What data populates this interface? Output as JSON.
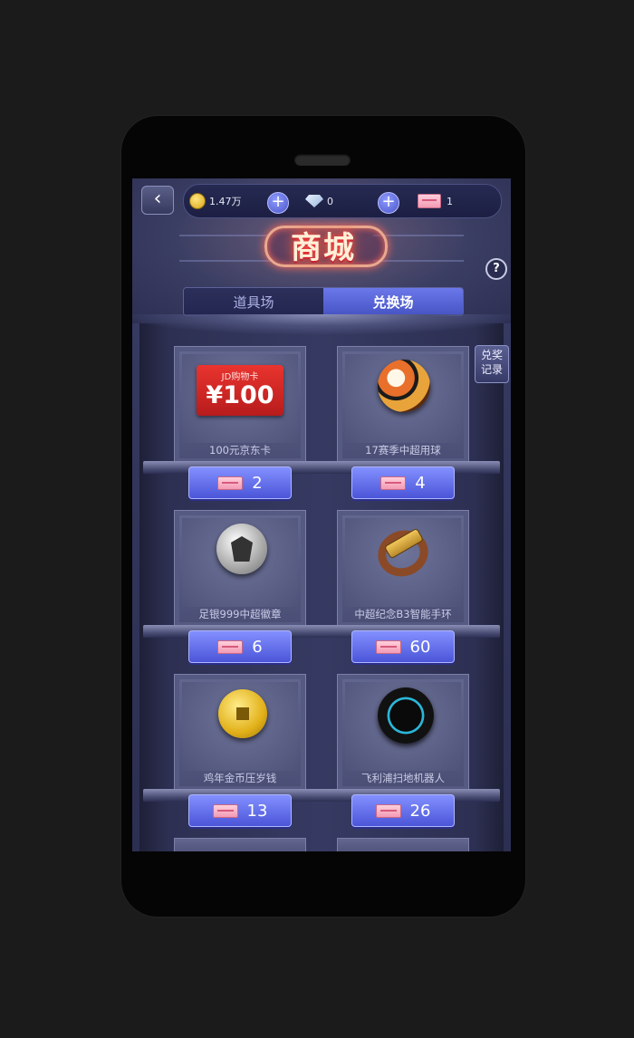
{
  "header": {
    "back_icon": "chevron-left-icon",
    "coins": "1.47万",
    "diamonds": "0",
    "tickets": "1",
    "title": "商城",
    "help": "?"
  },
  "tabs": [
    {
      "label": "道具场",
      "active": false
    },
    {
      "label": "兑换场",
      "active": true
    }
  ],
  "side_button": {
    "line1": "兑奖",
    "line2": "记录"
  },
  "items": [
    {
      "name": "100元京东卡",
      "price": "2",
      "art": "jd-card-icon",
      "art_text1": "JD购物卡",
      "art_text2": "¥100"
    },
    {
      "name": "17赛季中超用球",
      "price": "4",
      "art": "soccer-ball-icon"
    },
    {
      "name": "足银999中超徽章",
      "price": "6",
      "art": "silver-badge-icon"
    },
    {
      "name": "中超纪念B3智能手环",
      "price": "60",
      "art": "smart-band-icon"
    },
    {
      "name": "鸡年金币压岁钱",
      "price": "13",
      "art": "gold-coin-icon"
    },
    {
      "name": "飞利浦扫地机器人",
      "price": "26",
      "art": "robot-vacuum-icon"
    }
  ],
  "colors": {
    "accent": "#5a65e0",
    "background": "#1b1b1b"
  }
}
